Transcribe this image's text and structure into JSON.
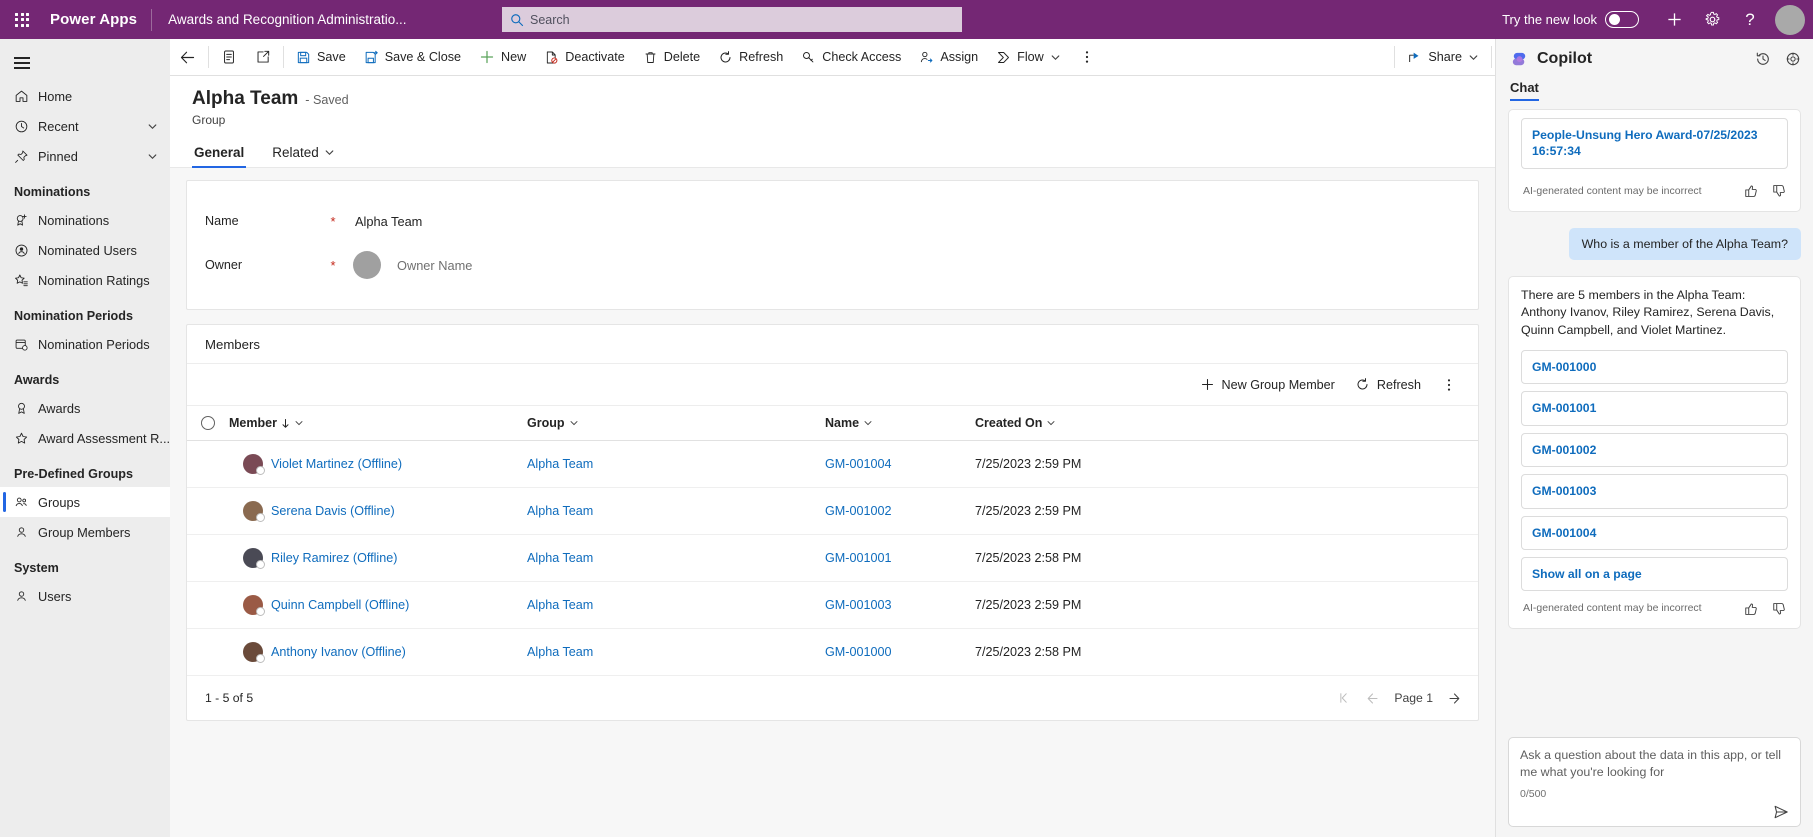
{
  "topbar": {
    "waffle_label": "app-launcher",
    "brand": "Power Apps",
    "app_name": "Awards and Recognition Administratio...",
    "search_placeholder": "Search",
    "search_value": "",
    "new_look_label": "Try the new look",
    "new_look_state": "off",
    "icons": [
      "plus-icon",
      "gear-icon",
      "help-icon",
      "avatar"
    ]
  },
  "sidebar": {
    "hamburger": "site-map-toggle",
    "items": [
      {
        "label": "Home",
        "icon": "home-icon",
        "chevron": false,
        "selected": false
      },
      {
        "label": "Recent",
        "icon": "clock-icon",
        "chevron": true,
        "selected": false
      },
      {
        "label": "Pinned",
        "icon": "pin-icon",
        "chevron": true,
        "selected": false
      }
    ],
    "groups": [
      {
        "title": "Nominations",
        "items": [
          {
            "label": "Nominations",
            "icon": "ribbon-add-icon",
            "selected": false
          },
          {
            "label": "Nominated Users",
            "icon": "person-badge-icon",
            "selected": false
          },
          {
            "label": "Nomination Ratings",
            "icon": "star-list-icon",
            "selected": false
          }
        ]
      },
      {
        "title": "Nomination Periods",
        "items": [
          {
            "label": "Nomination Periods",
            "icon": "calendar-clock-icon",
            "selected": false
          }
        ]
      },
      {
        "title": "Awards",
        "items": [
          {
            "label": "Awards",
            "icon": "award-medal-icon",
            "selected": false
          },
          {
            "label": "Award Assessment R...",
            "icon": "star-icon",
            "selected": false
          }
        ]
      },
      {
        "title": "Pre-Defined Groups",
        "items": [
          {
            "label": "Groups",
            "icon": "people-icon",
            "selected": true
          },
          {
            "label": "Group Members",
            "icon": "person-icon",
            "selected": false
          }
        ]
      },
      {
        "title": "System",
        "items": [
          {
            "label": "Users",
            "icon": "person-icon",
            "selected": false
          }
        ]
      }
    ]
  },
  "commandbar": {
    "back": "back-arrow-icon",
    "form_selector": "form-icon",
    "popout": "open-in-new-icon",
    "buttons": [
      {
        "label": "Save",
        "icon": "save-icon"
      },
      {
        "label": "Save & Close",
        "icon": "save-close-icon"
      },
      {
        "label": "New",
        "icon": "plus-icon"
      },
      {
        "label": "Deactivate",
        "icon": "deactivate-icon"
      },
      {
        "label": "Delete",
        "icon": "trash-icon"
      },
      {
        "label": "Refresh",
        "icon": "refresh-icon"
      },
      {
        "label": "Check Access",
        "icon": "key-icon"
      },
      {
        "label": "Assign",
        "icon": "person-assign-icon"
      },
      {
        "label": "Flow",
        "icon": "flow-icon",
        "chevron": true
      }
    ],
    "overflow": "more-vertical-icon",
    "share": {
      "label": "Share",
      "icon": "share-icon",
      "chevron": true
    }
  },
  "record": {
    "title": "Alpha Team",
    "saved_state": "- Saved",
    "entity": "Group",
    "tabs": [
      {
        "label": "General",
        "active": true,
        "chevron": false
      },
      {
        "label": "Related",
        "active": false,
        "chevron": true
      }
    ]
  },
  "form": {
    "fields": [
      {
        "label": "Name",
        "required": true,
        "value": "Alpha Team",
        "type": "text"
      },
      {
        "label": "Owner",
        "required": true,
        "value": "Owner Name",
        "type": "lookup-with-avatar"
      }
    ]
  },
  "subgrid": {
    "title": "Members",
    "toolbar": [
      {
        "label": "New Group Member",
        "icon": "plus-icon"
      },
      {
        "label": "Refresh",
        "icon": "refresh-icon"
      }
    ],
    "overflow": "more-vertical-icon",
    "columns": [
      {
        "label": "Member",
        "sorted": true,
        "sort_dir": "down"
      },
      {
        "label": "Group",
        "sorted": false
      },
      {
        "label": "Name",
        "sorted": false
      },
      {
        "label": "Created On",
        "sorted": false
      }
    ],
    "rows": [
      {
        "member": "Violet Martinez (Offline)",
        "avatar_color": "#7a4a55",
        "group": "Alpha Team",
        "name": "GM-001004",
        "created_on": "7/25/2023 2:59 PM"
      },
      {
        "member": "Serena Davis (Offline)",
        "avatar_color": "#8a6a50",
        "group": "Alpha Team",
        "name": "GM-001002",
        "created_on": "7/25/2023 2:59 PM"
      },
      {
        "member": "Riley Ramirez (Offline)",
        "avatar_color": "#4a4a55",
        "group": "Alpha Team",
        "name": "GM-001001",
        "created_on": "7/25/2023 2:58 PM"
      },
      {
        "member": "Quinn Campbell (Offline)",
        "avatar_color": "#9a5a45",
        "group": "Alpha Team",
        "name": "GM-001003",
        "created_on": "7/25/2023 2:59 PM"
      },
      {
        "member": "Anthony Ivanov (Offline)",
        "avatar_color": "#6a4a3a",
        "group": "Alpha Team",
        "name": "GM-001000",
        "created_on": "7/25/2023 2:58 PM"
      }
    ],
    "footer": {
      "range": "1 - 5 of 5",
      "page_label": "Page 1"
    }
  },
  "copilot": {
    "title": "Copilot",
    "logo": "copilot-icon",
    "header_actions": [
      "history-icon",
      "settings-icon"
    ],
    "tabs": [
      {
        "label": "Chat",
        "active": true
      }
    ],
    "top_partial_link": "People-Unsung Hero Award-07/25/2023 16:57:34",
    "disclaimer": "AI-generated content may be incorrect",
    "user_message": "Who is a member of the Alpha Team?",
    "answer": "There are 5 members in the Alpha Team: Anthony Ivanov, Riley Ramirez, Serena Davis, Quinn Campbell, and Violet Martinez.",
    "answer_links": [
      "GM-001000",
      "GM-001001",
      "GM-001002",
      "GM-001003",
      "GM-001004",
      "Show all on a page"
    ],
    "compose_placeholder": "Ask a question about the data in this app, or tell me what you're looking for",
    "compose_counter": "0/500",
    "send_icon": "send-icon"
  },
  "colors": {
    "brand_purple": "#742774",
    "link_blue": "#0f6cbd",
    "accent_blue": "#2266e3",
    "required_red": "#c4271a",
    "user_bubble": "#cfe4fa"
  }
}
